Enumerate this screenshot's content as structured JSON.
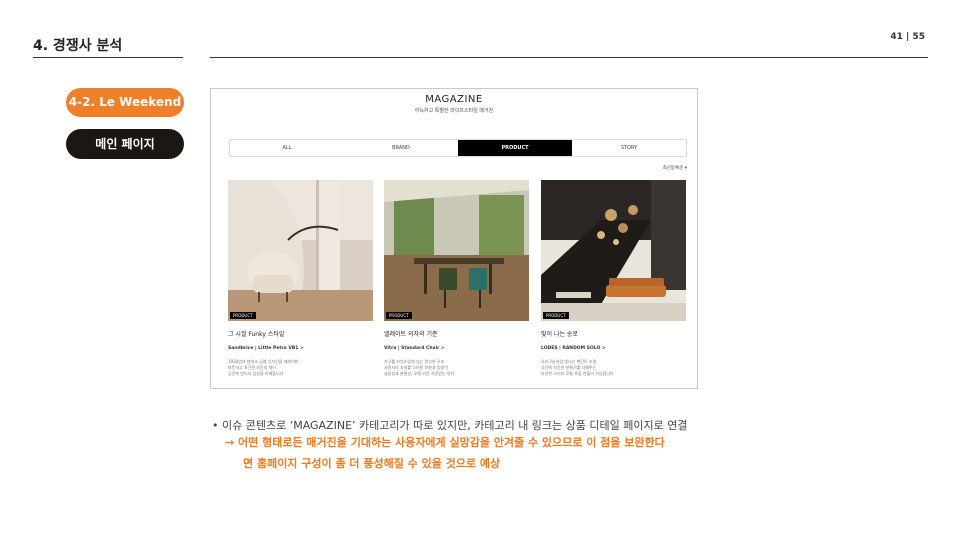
{
  "header": {
    "section_title": "4. 경쟁사 분석",
    "page_number": "41 | 55"
  },
  "labels": {
    "brand_pill": "4-2. Le Weekend",
    "page_pill": "메인 페이지"
  },
  "screenshot": {
    "title": "MAGAZINE",
    "subtitle": "아늑하고 특별한 라이프스타일 매거진",
    "tabs": [
      {
        "label": "ALL",
        "active": false
      },
      {
        "label": "BRAND",
        "active": false
      },
      {
        "label": "PRODUCT",
        "active": true
      },
      {
        "label": "STORY",
        "active": false
      }
    ],
    "sort_label": "최신등록순 ▾",
    "cards": [
      {
        "badge": "PRODUCT",
        "title": "그 시절 Funky 스타일",
        "sub": "Sandbrice | Little Petra VB1 >",
        "desc": [
          "1930년대 덴마크 공예 디자인을 재해석한",
          "따뜻하고 포근한 라운지 체어",
          "공간에 빈티지 감성을 더해줍니다"
        ]
      },
      {
        "badge": "PRODUCT",
        "title": "엘레이트 의자의 기준",
        "sub": "Vitra | Standard Chair >",
        "desc": [
          "가구를 자연스럽게 잇는 견고한 구조",
          "사용자의 자세를 고려한 좌판과 등받이",
          "실용성과 완결성, 오랜 기간 사랑받는 의자"
        ]
      },
      {
        "badge": "PRODUCT",
        "title": "빛이 나는 송로",
        "sub": "LODES | RANDOM SOLO >",
        "desc": [
          "유리구슬처럼 빛나는 펜던트 조명",
          "공간에 따뜻한 분위기를 더해주는",
          "다양한 크기의 모듈 조합 연출이 가능합니다"
        ]
      }
    ]
  },
  "notes": {
    "bullet": "이슈 콘텐츠로 ‘MAGAZINE’ 카테고리가 따로 있지만, 카테고리 내 링크는 상품 디테일 페이지로 연결",
    "conclusion_line1": "→ 어떤 형태로든 매거진을 기대하는 사용자에게 실망감을 안겨줄 수 있으므로 이 점을 보완한다",
    "conclusion_line2": "면 홈페이지 구성이 좀 더 풍성해질 수 있을 것으로 예상"
  },
  "colors": {
    "accent": "#f07f2a",
    "dark_pill": "#1d1714"
  }
}
